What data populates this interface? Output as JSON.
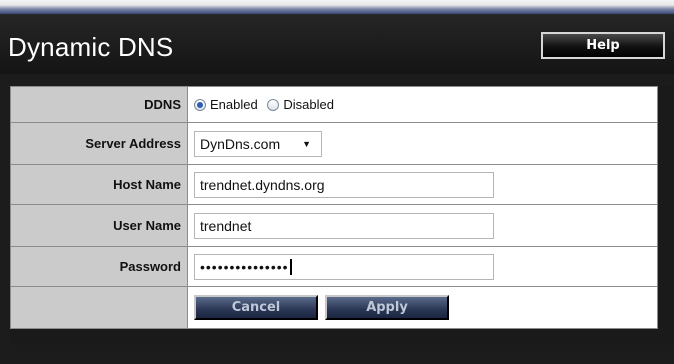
{
  "header": {
    "title": "Dynamic DNS",
    "help_label": "Help"
  },
  "form": {
    "ddns": {
      "label": "DDNS",
      "enabled_label": "Enabled",
      "disabled_label": "Disabled",
      "selected": "Enabled"
    },
    "server_address": {
      "label": "Server Address",
      "value": "DynDns.com"
    },
    "host_name": {
      "label": "Host Name",
      "value": "trendnet.dyndns.org"
    },
    "user_name": {
      "label": "User Name",
      "value": "trendnet"
    },
    "password": {
      "label": "Password",
      "masked": "•••••••••••••••"
    },
    "cancel_label": "Cancel",
    "apply_label": "Apply"
  }
}
